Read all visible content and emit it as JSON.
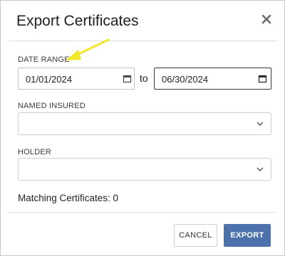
{
  "dialog": {
    "title": "Export Certificates",
    "close_icon": "close-icon"
  },
  "date_range": {
    "label": "DATE RANGE",
    "start": "01/01/2024",
    "separator": "to",
    "end": "06/30/2024",
    "icon": "calendar-icon"
  },
  "named_insured": {
    "label": "NAMED INSURED",
    "value": "",
    "icon": "chevron-down-icon"
  },
  "holder": {
    "label": "HOLDER",
    "value": "",
    "icon": "chevron-down-icon"
  },
  "matching": {
    "text": "Matching Certificates: 0"
  },
  "actions": {
    "cancel_label": "CANCEL",
    "export_label": "EXPORT"
  },
  "colors": {
    "primary": "#4d72ab",
    "annotation_arrow": "#f2e72a"
  }
}
